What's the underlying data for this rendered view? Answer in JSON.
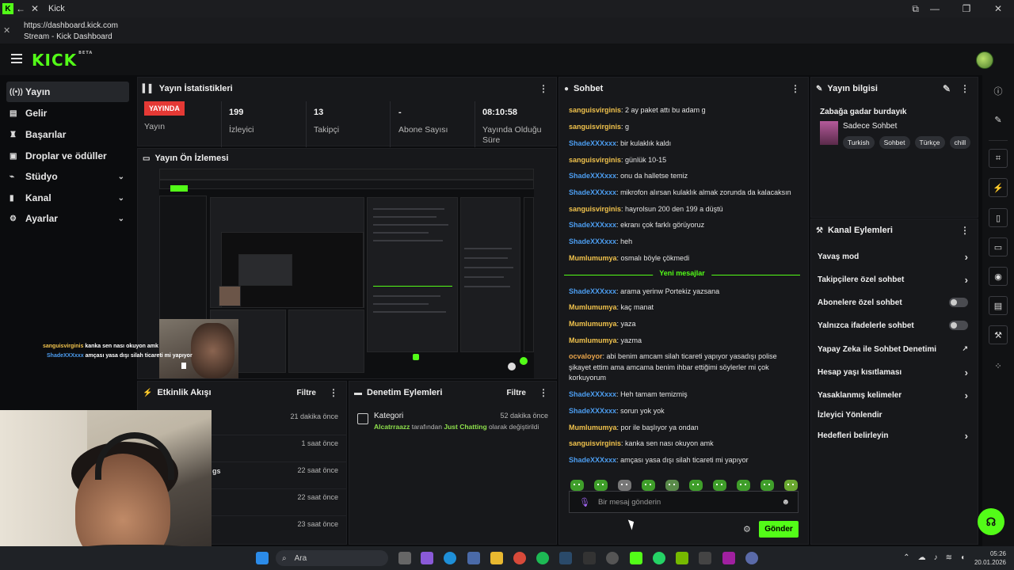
{
  "window": {
    "title": "Kick",
    "url": "https://dashboard.kick.com",
    "page_title": "Stream - Kick Dashboard"
  },
  "brand": {
    "logo": "KICK",
    "logo_badge": "BETA",
    "accent": "#53fc18"
  },
  "sidebar": {
    "items": [
      {
        "label": "Yayın",
        "icon": "broadcast-icon",
        "active": true
      },
      {
        "label": "Gelir",
        "icon": "revenue-icon"
      },
      {
        "label": "Başarılar",
        "icon": "trophy-icon"
      },
      {
        "label": "Droplar ve ödüller",
        "icon": "gift-icon"
      },
      {
        "label": "Stüdyo",
        "icon": "studio-icon",
        "expandable": true
      },
      {
        "label": "Kanal",
        "icon": "channel-icon",
        "expandable": true
      },
      {
        "label": "Ayarlar",
        "icon": "gear-icon",
        "expandable": true
      }
    ]
  },
  "stats": {
    "title": "Yayın İstatistikleri",
    "live_badge": "YAYINDA",
    "live_label": "Yayın",
    "viewers_value": "199",
    "viewers_label": "İzleyici",
    "followers_value": "13",
    "followers_label": "Takipçi",
    "subs_value": "-",
    "subs_label": "Abone Sayısı",
    "time_value": "08:10:58",
    "time_label": "Yayında Olduğu Süre"
  },
  "preview": {
    "title": "Yayın Ön İzlemesi",
    "overlay_chat": [
      {
        "user": "sanguisvirginis",
        "text": "kanka sen nası okuyon amk"
      },
      {
        "user": "ShadeXXXxxx",
        "text": "amçası yasa dışı silah ticareti mi yapıyor"
      }
    ]
  },
  "activity": {
    "title": "Etkinlik Akışı",
    "filter": "Filtre",
    "rows": [
      {
        "time": "21 dakika önce",
        "fragment": ""
      },
      {
        "time": "1 saat önce",
        "fragment": ""
      },
      {
        "time": "22 saat önce",
        "fragment": "gs"
      },
      {
        "time": "22 saat önce",
        "fragment": ""
      },
      {
        "time": "23 saat önce",
        "fragment": ""
      }
    ]
  },
  "moderation": {
    "title": "Denetim Eylemleri",
    "filter": "Filtre",
    "entry": {
      "category": "Kategori",
      "time": "52 dakika önce",
      "actor": "Alcatrraazz",
      "by_text": " tarafından ",
      "target": "Just Chatting",
      "suffix": " olarak değiştirildi"
    }
  },
  "chat": {
    "title": "Sohbet",
    "messages": [
      {
        "user": "sanguisvirginis",
        "color": "yellow",
        "text": "2 ay paket attı bu adam g"
      },
      {
        "user": "sanguisvirginis",
        "color": "yellow",
        "text": "g"
      },
      {
        "user": "ShadeXXXxxx",
        "color": "blue",
        "text": "bir kulaklık kaldı"
      },
      {
        "user": "sanguisvirginis",
        "color": "yellow",
        "text": "günlük 10-15"
      },
      {
        "user": "ShadeXXXxxx",
        "color": "blue",
        "text": "onu da halletse temiz"
      },
      {
        "user": "ShadeXXXxxx",
        "color": "blue",
        "text": "mikrofon alırsan kulaklık almak zorunda da kalacaksın"
      },
      {
        "user": "sanguisvirginis",
        "color": "yellow",
        "text": "hayrolsun 200 den 199 a düştü"
      },
      {
        "user": "ShadeXXXxxx",
        "color": "blue",
        "text": "ekranı çok farklı görüyoruz"
      },
      {
        "user": "ShadeXXXxxx",
        "color": "blue",
        "text": "heh"
      },
      {
        "user": "Mumlumumya",
        "color": "yellow",
        "text": "osmalı böyle çökmedi"
      }
    ],
    "new_messages_label": "Yeni mesajlar",
    "new_messages": [
      {
        "user": "ShadeXXXxxx",
        "color": "blue",
        "text": "arama yerinw Portekiz yazsana"
      },
      {
        "user": "Mumlumumya",
        "color": "yellow",
        "text": "kaç manat"
      },
      {
        "user": "Mumlumumya",
        "color": "yellow",
        "text": "yaza"
      },
      {
        "user": "Mumlumumya",
        "color": "yellow",
        "text": "yazma"
      },
      {
        "user": "ocvaloyor",
        "color": "orange",
        "text": "abi benim amcam silah ticareti yapıyor yasadışı polise şikayet ettim ama amcama benim ihbar ettiğimi söylerler mi çok korkuyorum"
      },
      {
        "user": "ShadeXXXxxx",
        "color": "blue",
        "text": "Heh tamam temizmiş"
      },
      {
        "user": "ShadeXXXxxx",
        "color": "blue",
        "text": "sorun yok yok"
      },
      {
        "user": "Mumlumumya",
        "color": "yellow",
        "text": "por ile başlıyor ya ondan"
      },
      {
        "user": "sanguisvirginis",
        "color": "yellow",
        "text": "kanka sen nası okuyon amk"
      },
      {
        "user": "ShadeXXXxxx",
        "color": "blue",
        "text": "amçası yasa dışı silah ticareti mi yapıyor"
      }
    ],
    "input_placeholder": "Bir mesaj gönderin",
    "send_label": "Gönder"
  },
  "stream_info": {
    "title": "Yayın bilgisi",
    "stream_title": "Zabağa gadar burdayık",
    "category": "Sadece Sohbet",
    "tags": [
      "Turkish",
      "Sohbet",
      "Türkçe",
      "chill"
    ]
  },
  "channel_actions": {
    "title": "Kanal Eylemleri",
    "items": [
      {
        "label": "Yavaş mod",
        "control": "chevron"
      },
      {
        "label": "Takipçilere özel sohbet",
        "control": "chevron"
      },
      {
        "label": "Abonelere özel sohbet",
        "control": "toggle",
        "on": false
      },
      {
        "label": "Yalnızca ifadelerle sohbet",
        "control": "toggle",
        "on": false
      },
      {
        "label": "Yapay Zeka ile Sohbet Denetimi",
        "control": "external"
      },
      {
        "label": "Hesap yaşı kısıtlaması",
        "control": "chevron"
      },
      {
        "label": "Yasaklanmış kelimeler",
        "control": "chevron"
      },
      {
        "label": "İzleyici Yönlendir",
        "control": "none"
      },
      {
        "label": "Hedefleri belirleyin",
        "control": "chevron"
      }
    ]
  },
  "taskbar": {
    "search_label": "Ara",
    "time": "05:26",
    "date": "20.01.2026"
  }
}
